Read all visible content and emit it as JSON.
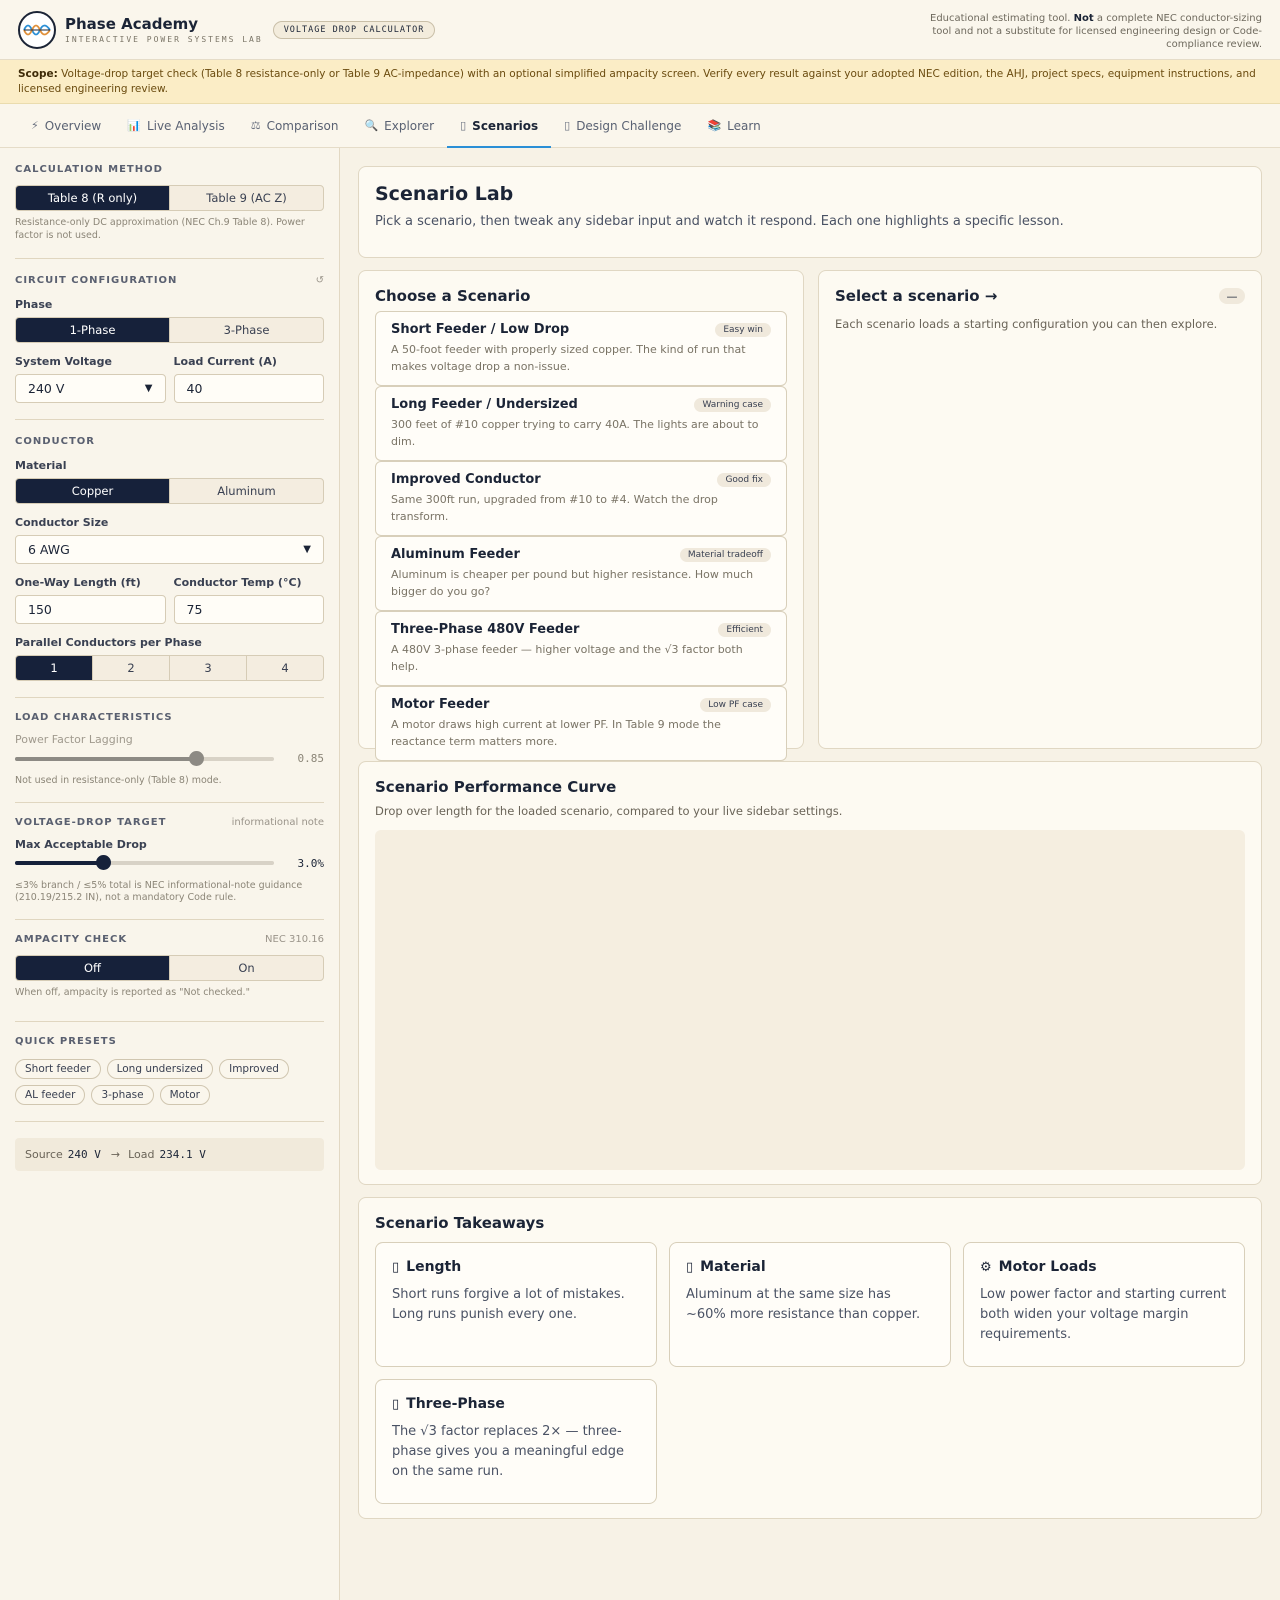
{
  "header": {
    "brand_name": "Phase Academy",
    "brand_sub": "INTERACTIVE POWER SYSTEMS LAB",
    "tool_badge": "VOLTAGE DROP CALCULATOR",
    "disclaimer_pre": "Educational estimating tool. ",
    "disclaimer_bold": "Not",
    "disclaimer_post": " a complete NEC conductor-sizing tool and not a substitute for licensed engineering design or Code-compliance review."
  },
  "scope": {
    "label": "Scope:",
    "text": " Voltage-drop target check (Table 8 resistance-only or Table 9 AC-impedance) with an optional simplified ampacity screen. Verify every result against your adopted NEC edition, the AHJ, project specs, equipment instructions, and licensed engineering review."
  },
  "tabs": [
    {
      "label": "Overview",
      "icon": "⚡"
    },
    {
      "label": "Live Analysis",
      "icon": "📊"
    },
    {
      "label": "Comparison",
      "icon": "⚖"
    },
    {
      "label": "Explorer",
      "icon": "🔍"
    },
    {
      "label": "Scenarios",
      "icon": "▯"
    },
    {
      "label": "Design Challenge",
      "icon": "▯"
    },
    {
      "label": "Learn",
      "icon": "📚"
    }
  ],
  "active_tab": "Scenarios",
  "sidebar": {
    "method_title": "CALCULATION METHOD",
    "method_options": [
      "Table 8 (R only)",
      "Table 9 (AC Z)"
    ],
    "method_help": "Resistance-only DC approximation (NEC Ch.9 Table 8). Power factor is not used.",
    "circuit_title": "CIRCUIT CONFIGURATION",
    "reset_icon": "↺",
    "phase_label": "Phase",
    "phase_options": [
      "1-Phase",
      "3-Phase"
    ],
    "voltage_label": "System Voltage",
    "voltage_value": "240 V",
    "current_label": "Load Current (A)",
    "current_value": "40",
    "conductor_title": "CONDUCTOR",
    "material_label": "Material",
    "material_options": [
      "Copper",
      "Aluminum"
    ],
    "size_label": "Conductor Size",
    "size_value": "6 AWG",
    "length_label": "One-Way Length (ft)",
    "length_value": "150",
    "temp_label": "Conductor Temp (°C)",
    "temp_value": "75",
    "parallel_label": "Parallel Conductors per Phase",
    "parallel_options": [
      "1",
      "2",
      "3",
      "4"
    ],
    "load_title": "LOAD CHARACTERISTICS",
    "pf_label": "Power Factor Lagging",
    "pf_value": "0.85",
    "pf_fraction": 0.7,
    "pf_help": "Not used in resistance-only (Table 8) mode.",
    "vd_title": "VOLTAGE-DROP TARGET",
    "vd_note": "informational note",
    "vd_label": "Max Acceptable Drop",
    "vd_value": "3.0%",
    "vd_fraction": 0.34,
    "vd_help": "≤3% branch / ≤5% total is NEC informational-note guidance (210.19/215.2 IN), not a mandatory Code rule.",
    "amp_title": "AMPACITY CHECK",
    "amp_note": "NEC 310.16",
    "amp_options": [
      "Off",
      "On"
    ],
    "amp_help": "When off, ampacity is reported as \"Not checked.\"",
    "presets_title": "QUICK PRESETS",
    "presets": [
      "Short feeder",
      "Long undersized",
      "Improved",
      "AL feeder",
      "3-phase",
      "Motor"
    ],
    "source_label": "Source",
    "source_value": "240 V",
    "arrow": "→",
    "load_label": "Load",
    "load_value": "234.1 V"
  },
  "lab": {
    "title": "Scenario Lab",
    "desc": "Pick a scenario, then tweak any sidebar input and watch it respond. Each one highlights a specific lesson."
  },
  "choose": {
    "title": "Choose a Scenario",
    "scenarios": [
      {
        "title": "Short Feeder / Low Drop",
        "badge": "Easy win",
        "desc": "A 50-foot feeder with properly sized copper. The kind of run that makes voltage drop a non-issue."
      },
      {
        "title": "Long Feeder / Undersized",
        "badge": "Warning case",
        "desc": "300 feet of #10 copper trying to carry 40A. The lights are about to dim."
      },
      {
        "title": "Improved Conductor",
        "badge": "Good fix",
        "desc": "Same 300ft run, upgraded from #10 to #4. Watch the drop transform."
      },
      {
        "title": "Aluminum Feeder",
        "badge": "Material tradeoff",
        "desc": "Aluminum is cheaper per pound but higher resistance. How much bigger do you go?"
      },
      {
        "title": "Three-Phase 480V Feeder",
        "badge": "Efficient",
        "desc": "A 480V 3-phase feeder — higher voltage and the √3 factor both help."
      },
      {
        "title": "Motor Feeder",
        "badge": "Low PF case",
        "desc": "A motor draws high current at lower PF. In Table 9 mode the reactance term matters more."
      }
    ]
  },
  "select": {
    "title": "Select a scenario →",
    "button": "—",
    "desc": "Each scenario loads a starting configuration you can then explore."
  },
  "curve": {
    "title": "Scenario Performance Curve",
    "desc": "Drop over length for the loaded scenario, compared to your live sidebar settings."
  },
  "takeaways": {
    "title": "Scenario Takeaways",
    "items": [
      {
        "icon": "▯",
        "title": "Length",
        "text": "Short runs forgive a lot of mistakes. Long runs punish every one."
      },
      {
        "icon": "▯",
        "title": "Material",
        "text": "Aluminum at the same size has ~60% more resistance than copper."
      },
      {
        "icon": "⚙",
        "title": "Motor Loads",
        "text": "Low power factor and starting current both widen your voltage margin requirements."
      },
      {
        "icon": "▯",
        "title": "Three-Phase",
        "text": "The √3 factor replaces 2× — three-phase gives you a meaningful edge on the same run."
      }
    ]
  }
}
